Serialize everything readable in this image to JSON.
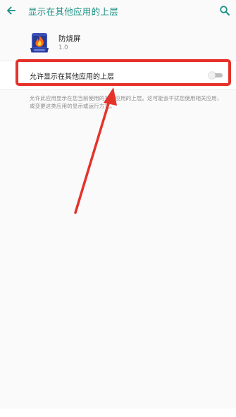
{
  "appbar": {
    "back_icon": "arrow-left-icon",
    "title": "显示在其他应用的上层",
    "search_icon": "search-icon"
  },
  "app": {
    "name": "防烧屏",
    "version": "1.0",
    "icon": "app-flame-icon"
  },
  "setting": {
    "label": "允许显示在其他应用的上层",
    "toggle_on": false
  },
  "description": "允许此应用显示在您当前使用的其他应用的上层。这可能会干扰您使用相关应用，或变更这类应用的显示或运行方式。",
  "colors": {
    "accent": "#1a8f83",
    "annotation": "#e5322a",
    "background": "#fafafa"
  }
}
